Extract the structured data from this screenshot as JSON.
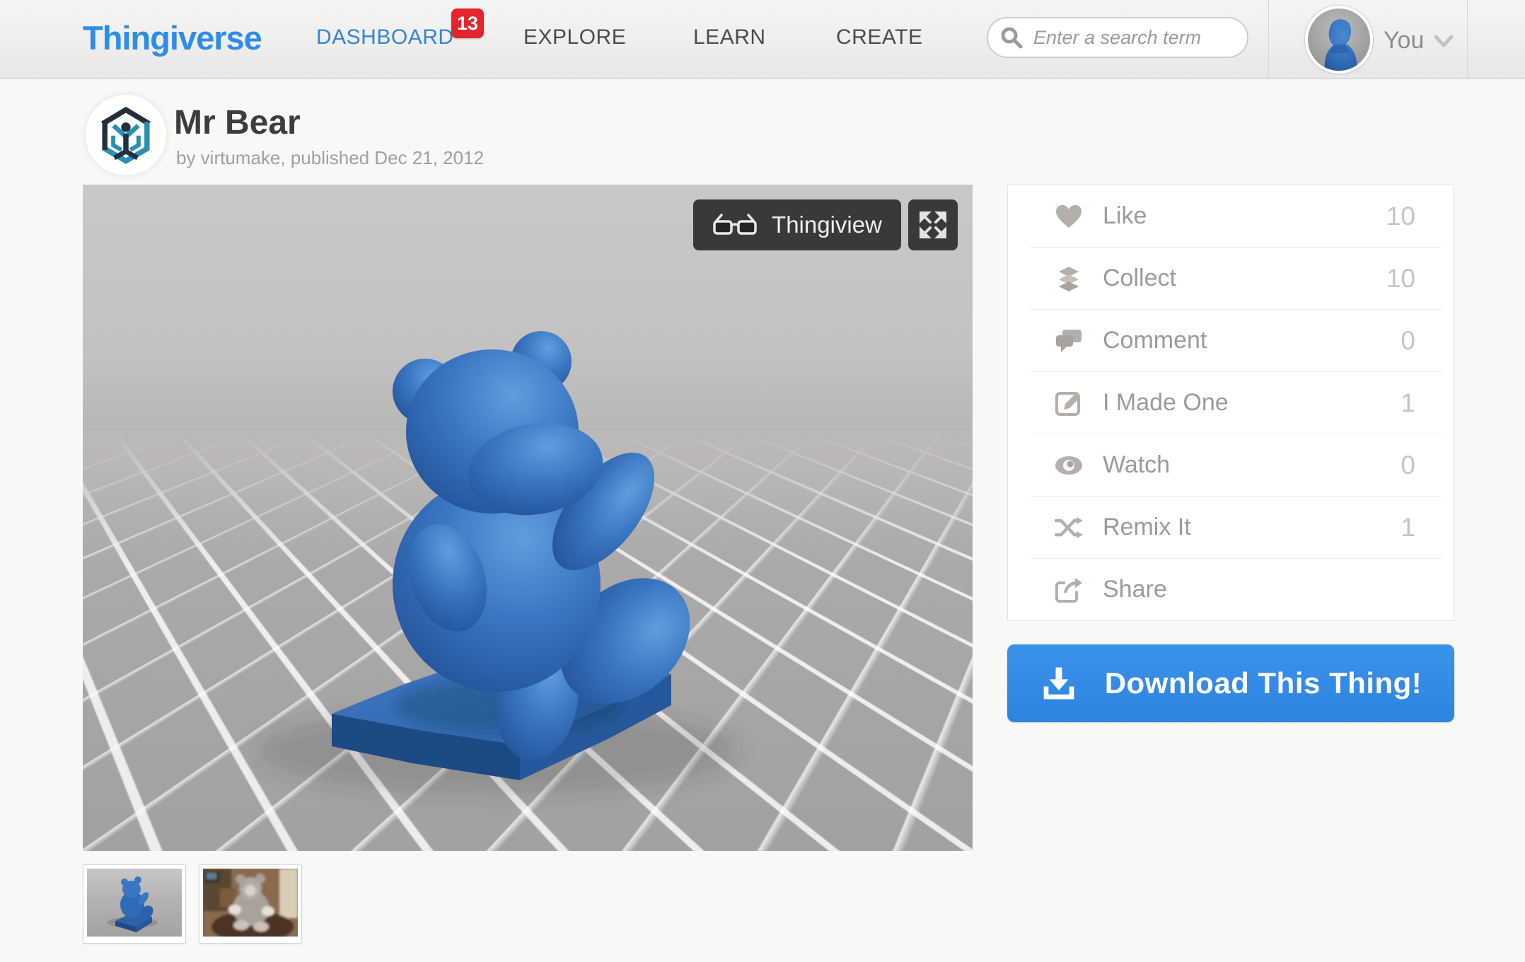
{
  "header": {
    "brand": "Thingiverse",
    "nav": [
      {
        "label": "DASHBOARD",
        "badge": "13"
      },
      {
        "label": "EXPLORE"
      },
      {
        "label": "LEARN"
      },
      {
        "label": "CREATE"
      }
    ],
    "search": {
      "placeholder": "Enter a search term"
    },
    "user": {
      "label": "You"
    }
  },
  "thing": {
    "title": "Mr Bear",
    "byline": "by virtumake, published Dec 21, 2012"
  },
  "viewer": {
    "thingiview_label": "Thingiview"
  },
  "actions": {
    "rows": [
      {
        "label": "Like",
        "count": "10",
        "icon": "heart-icon"
      },
      {
        "label": "Collect",
        "count": "10",
        "icon": "collect-icon"
      },
      {
        "label": "Comment",
        "count": "0",
        "icon": "comment-icon"
      },
      {
        "label": "I Made One",
        "count": "1",
        "icon": "made-one-icon"
      },
      {
        "label": "Watch",
        "count": "0",
        "icon": "watch-icon"
      },
      {
        "label": "Remix It",
        "count": "1",
        "icon": "remix-icon"
      },
      {
        "label": "Share",
        "count": "",
        "icon": "share-icon"
      }
    ]
  },
  "download": {
    "label": "Download This Thing!"
  },
  "thumbnails": [
    {
      "name": "render-thumbnail"
    },
    {
      "name": "photo-thumbnail"
    }
  ],
  "colors": {
    "brand_blue": "#2f8ce8",
    "nav_active_blue": "#3285d6",
    "badge_red": "#e7242b",
    "download_blue": "#318ae4",
    "bear_blue": "#2f6cb8",
    "viewer_gray": "#b5b3b1"
  }
}
